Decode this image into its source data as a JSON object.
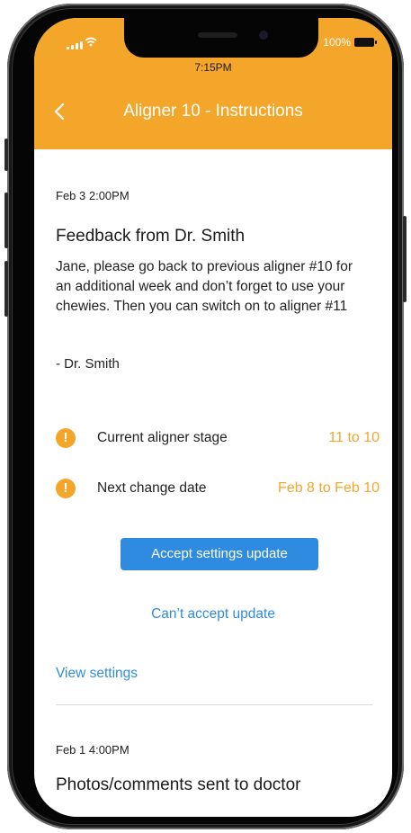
{
  "status_bar": {
    "battery_percent": "100%",
    "time": "7:15PM"
  },
  "header": {
    "title": "Aligner 10 - Instructions",
    "back_icon": "chevron-left-icon",
    "background_color": "#f4a62a"
  },
  "feedback": {
    "timestamp": "Feb 3 2:00PM",
    "title": "Feedback from Dr. Smith",
    "message": "Jane, please go back to previous aligner #10 for an additional week and don’t forget to use your chewies. Then you can switch on to aligner #11",
    "signature": "- Dr. Smith",
    "info_rows": [
      {
        "icon": "exclamation-icon",
        "label": "Current aligner stage",
        "value": "11 to 10"
      },
      {
        "icon": "exclamation-icon",
        "label": "Next change date",
        "value": "Feb 8 to Feb 10"
      }
    ],
    "accept_label": "Accept settings update",
    "cant_accept_label": "Can’t accept update",
    "view_settings_label": "View settings"
  },
  "next_entry": {
    "timestamp": "Feb 1 4:00PM",
    "title": "Photos/comments sent to doctor"
  },
  "colors": {
    "accent_orange": "#f4a62a",
    "link_blue": "#2f8be0"
  }
}
